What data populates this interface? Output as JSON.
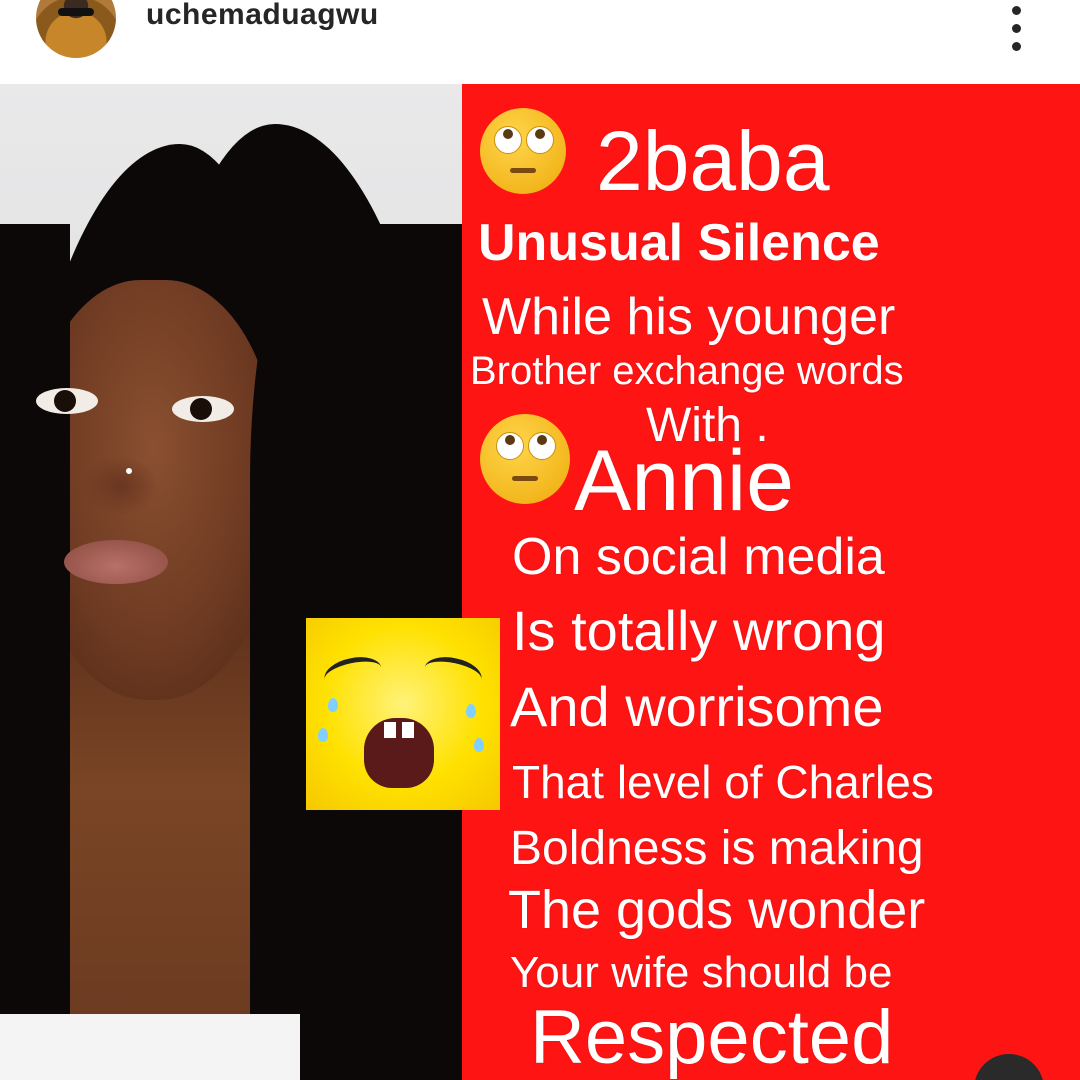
{
  "header": {
    "username": "uchemaduagwu",
    "avatar_icon": "profile-avatar",
    "more_icon": "more-vertical-icon"
  },
  "post": {
    "panel_color": "#ff1414",
    "text_color": "#ffffff",
    "emoji": {
      "eye_roll": "eye-roll-emoji",
      "crying": "crying-face-emoji"
    },
    "lines": {
      "l1": "2baba",
      "l2": "Unusual  Silence",
      "l3": "While his younger",
      "l4": "Brother exchange words",
      "l5": "With .",
      "l6": "Annie",
      "l7": "On social media",
      "l8": "Is totally wrong",
      "l9": "And worrisome",
      "l10": "That level of Charles",
      "l11": "Boldness is making",
      "l12": "The gods wonder",
      "l13": "Your wife should be",
      "l14": "Respected"
    }
  }
}
